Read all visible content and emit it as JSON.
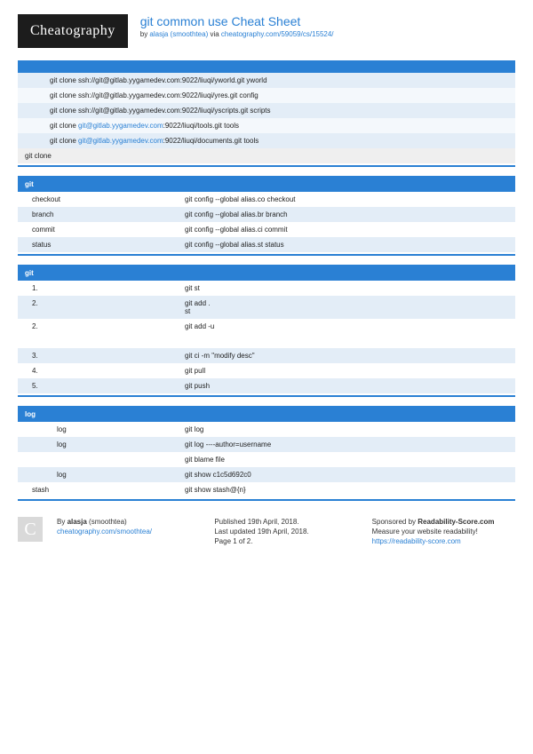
{
  "logo": "Cheatography",
  "title": "git common use Cheat Sheet",
  "byline_prefix": "by ",
  "author": "alasja (smoothtea)",
  "byline_via": " via ",
  "url": "cheatography.com/59059/cs/15524/",
  "section1": {
    "rows": [
      {
        "text": "git clone ssh://git@gitlab.yygamedev.com:9022/liuqi/yworld.git yworld",
        "alt": true
      },
      {
        "text": "git clone ssh://git@gitlab.yygamedev.com:9022/liuqi/yres.git config",
        "alt": false
      },
      {
        "text": "git clone ssh://git@gitlab.yygamedev.com:9022/liuqi/yscripts.git scripts",
        "alt": true
      },
      {
        "pre": "git clone ",
        "link": "git@gitlab.yygamedev.com",
        "post": ":9022/liuqi/tools.git tools",
        "alt": false
      },
      {
        "pre": "git clone ",
        "link": "git@gitlab.yygamedev.com",
        "post": ":9022/liuqi/documents.git tools",
        "alt": true
      }
    ],
    "footer": "git clone"
  },
  "section2": {
    "heading": "git",
    "rows": [
      {
        "c1": "checkout",
        "c2": "git config --global alias.co checkout",
        "alt": false
      },
      {
        "c1": "branch",
        "c2": "git config --global alias.br branch",
        "alt": true
      },
      {
        "c1": "commit",
        "c2": "git config --global alias.ci commit",
        "alt": false
      },
      {
        "c1": "status",
        "c2": "git config --global alias.st status",
        "alt": true
      }
    ]
  },
  "section3": {
    "heading": "git",
    "rows": [
      {
        "c1": "1.",
        "c2": "git st",
        "alt": false
      },
      {
        "c1": "2.",
        "c2": "git add .",
        "c2b": "st",
        "alt": true
      },
      {
        "c1": "2.",
        "c2": "git add -u",
        "alt": false,
        "tall": true
      },
      {
        "c1": "3.",
        "c2": "git ci -m \"modify desc\"",
        "alt": true
      },
      {
        "c1": "4.",
        "c2": "git pull",
        "alt": false
      },
      {
        "c1": "5.",
        "c2": "git push",
        "alt": true
      }
    ]
  },
  "section4": {
    "heading": "log",
    "rows": [
      {
        "c1": "log",
        "c2": "git log",
        "alt": false,
        "indent": true
      },
      {
        "c1": "log",
        "c2": "git log ----author=username",
        "alt": true,
        "indent": true
      },
      {
        "c1": "",
        "c2": "git blame file",
        "alt": false,
        "indent": true
      },
      {
        "c1": "log",
        "c2": "git show c1c5d692c0",
        "alt": true,
        "indent": true
      },
      {
        "c1": "stash",
        "c2": "git show stash@{n}",
        "alt": false
      }
    ]
  },
  "footer": {
    "avatar": "C",
    "by_label": "By ",
    "author": "alasja",
    "author_paren": " (smoothtea)",
    "author_url": "cheatography.com/smoothtea/",
    "pub": "Published 19th April, 2018.",
    "upd": "Last updated 19th April, 2018.",
    "page": "Page 1 of 2.",
    "spons_label": "Sponsored by ",
    "spons_name": "Readability-Score.com",
    "spons_desc": "Measure your website readability!",
    "spons_url": "https://readability-score.com"
  }
}
